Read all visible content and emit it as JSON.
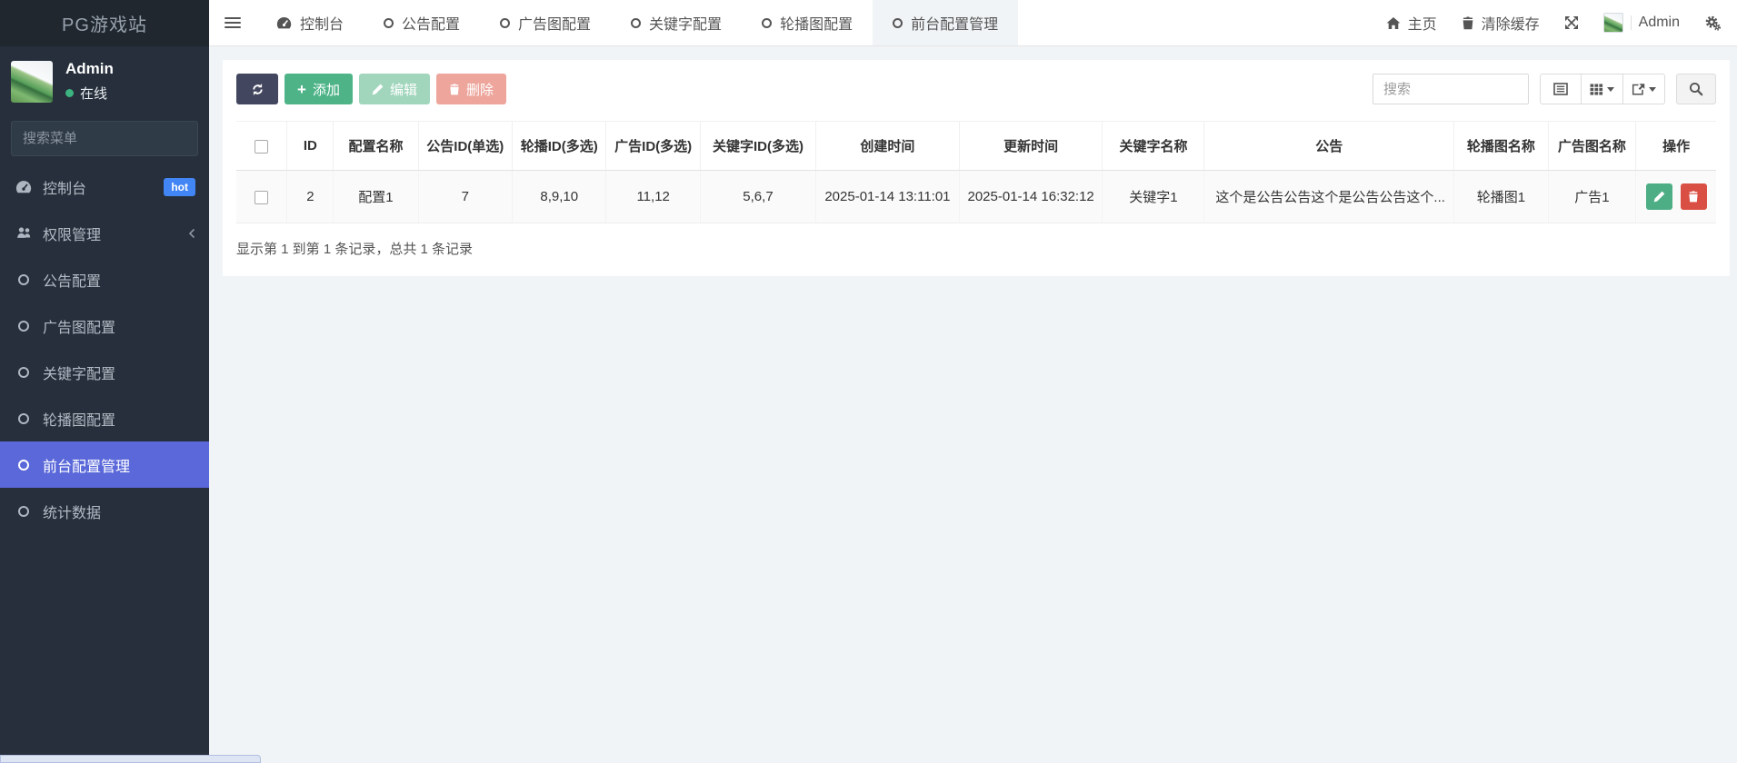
{
  "brand": {
    "title": "PG游戏站"
  },
  "user_panel": {
    "name": "Admin",
    "status": "在线"
  },
  "sidebar": {
    "search_placeholder": "搜索菜单",
    "items": [
      {
        "label": "控制台",
        "icon": "dashboard-icon",
        "badge": "hot",
        "active": false
      },
      {
        "label": "权限管理",
        "icon": "users-icon",
        "chevron": "collapsed",
        "active": false
      },
      {
        "label": "公告配置",
        "icon": "circle-icon",
        "active": false
      },
      {
        "label": "广告图配置",
        "icon": "circle-icon",
        "active": false
      },
      {
        "label": "关键字配置",
        "icon": "circle-icon",
        "active": false
      },
      {
        "label": "轮播图配置",
        "icon": "circle-icon",
        "active": false
      },
      {
        "label": "前台配置管理",
        "icon": "circle-icon",
        "active": true
      },
      {
        "label": "统计数据",
        "icon": "circle-icon",
        "active": false
      }
    ]
  },
  "topnav": {
    "tabs": [
      {
        "label": "控制台",
        "icon": "dashboard-icon",
        "active": false
      },
      {
        "label": "公告配置",
        "icon": "circle-icon",
        "active": false
      },
      {
        "label": "广告图配置",
        "icon": "circle-icon",
        "active": false
      },
      {
        "label": "关键字配置",
        "icon": "circle-icon",
        "active": false
      },
      {
        "label": "轮播图配置",
        "icon": "circle-icon",
        "active": false
      },
      {
        "label": "前台配置管理",
        "icon": "circle-icon",
        "active": true
      }
    ],
    "right": {
      "home": "主页",
      "clear_cache": "清除缓存",
      "username": "Admin"
    }
  },
  "toolbar": {
    "add_label": "添加",
    "edit_label": "编辑",
    "delete_label": "删除",
    "search_placeholder": "搜索"
  },
  "table": {
    "columns": [
      "ID",
      "配置名称",
      "公告ID(单选)",
      "轮播ID(多选)",
      "广告ID(多选)",
      "关键字ID(多选)",
      "创建时间",
      "更新时间",
      "关键字名称",
      "公告",
      "轮播图名称",
      "广告图名称",
      "操作"
    ],
    "rows": [
      {
        "id": "2",
        "config_name": "配置1",
        "notice_id": "7",
        "carousel_ids": "8,9,10",
        "ad_ids": "11,12",
        "keyword_ids": "5,6,7",
        "created_at": "2025-01-14 13:11:01",
        "updated_at": "2025-01-14 16:32:12",
        "keyword_name": "关键字1",
        "notice": "这个是公告公告这个是公告公告这个...",
        "carousel_name": "轮播图1",
        "ad_name": "广告1"
      }
    ],
    "summary": "显示第 1 到第 1 条记录，总共 1 条记录"
  },
  "colors": {
    "sidebar_bg": "#262f3b",
    "active_menu": "#5a68d9",
    "hot_badge": "#4285f4",
    "success_green": "#4eb488",
    "danger_red": "#da4f44",
    "refresh_dark": "#42465e",
    "content_bg": "#f1f4f6"
  }
}
